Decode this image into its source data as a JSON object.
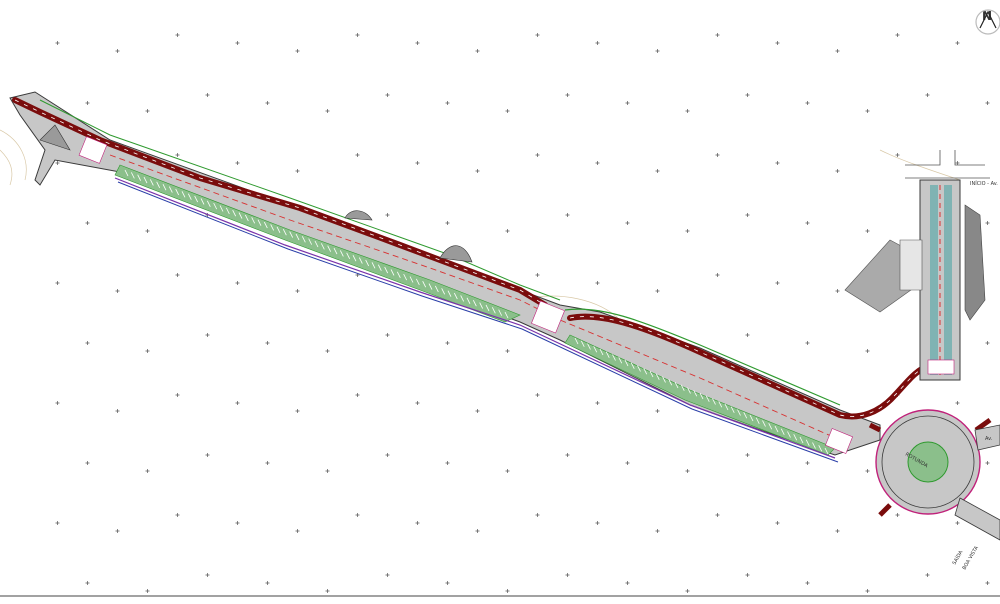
{
  "drawing": {
    "north_arrow_label": "N",
    "road_labels": {
      "top_right": "INÍCIO - Av.",
      "right_mid": "Av.",
      "bottom_right_a": "SAÍDA",
      "bottom_right_b": "BOA VISTA"
    },
    "roundabout_label": "ROTUNDA",
    "colors": {
      "road_fill": "#b9b9b9",
      "road_edge": "#3a3a3a",
      "cycle_lane": "#7a0c0c",
      "median_green": "#8bbf8b",
      "parking_grey": "#9a9a9a",
      "edge_green": "#2f9a2f",
      "edge_purple": "#7a33aa",
      "edge_blue": "#2a3ea8",
      "marker": "#555555",
      "hatch": "#666666",
      "curb_magenta": "#c0217a"
    }
  }
}
